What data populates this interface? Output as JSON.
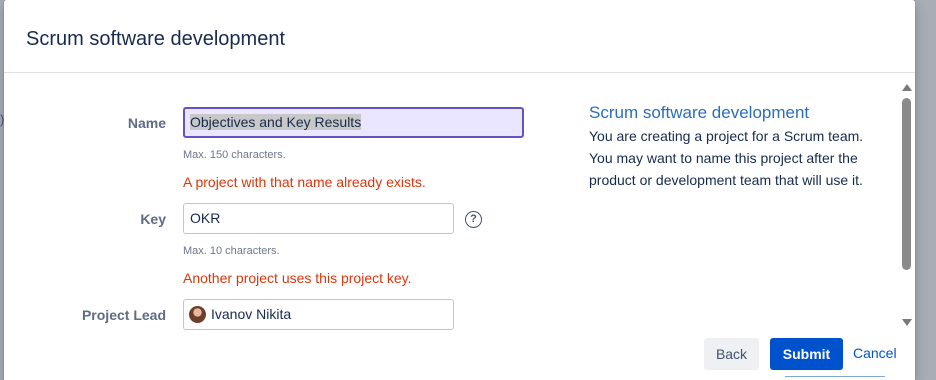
{
  "dialog": {
    "title": "Scrum software development"
  },
  "form": {
    "name": {
      "label": "Name",
      "value": "Objectives and Key Results",
      "hint": "Max. 150 characters.",
      "error": "A project with that name already exists."
    },
    "key": {
      "label": "Key",
      "value": "OKR",
      "help_icon": "question-circle-icon",
      "hint": "Max. 10 characters.",
      "error": "Another project uses this project key."
    },
    "lead": {
      "label": "Project Lead",
      "value": "Ivanov Nikita",
      "avatar_icon": "user-avatar"
    }
  },
  "sidebar": {
    "title": "Scrum software development",
    "description": "You are creating a project for a Scrum team. You may want to name this project after the product or development team that will use it."
  },
  "footer": {
    "back_label": "Back",
    "submit_label": "Submit",
    "cancel_label": "Cancel"
  },
  "colors": {
    "primary": "#0052cc",
    "error": "#de350b",
    "focus_border": "#6554c0",
    "sidebar_title": "#2a6ebb"
  }
}
